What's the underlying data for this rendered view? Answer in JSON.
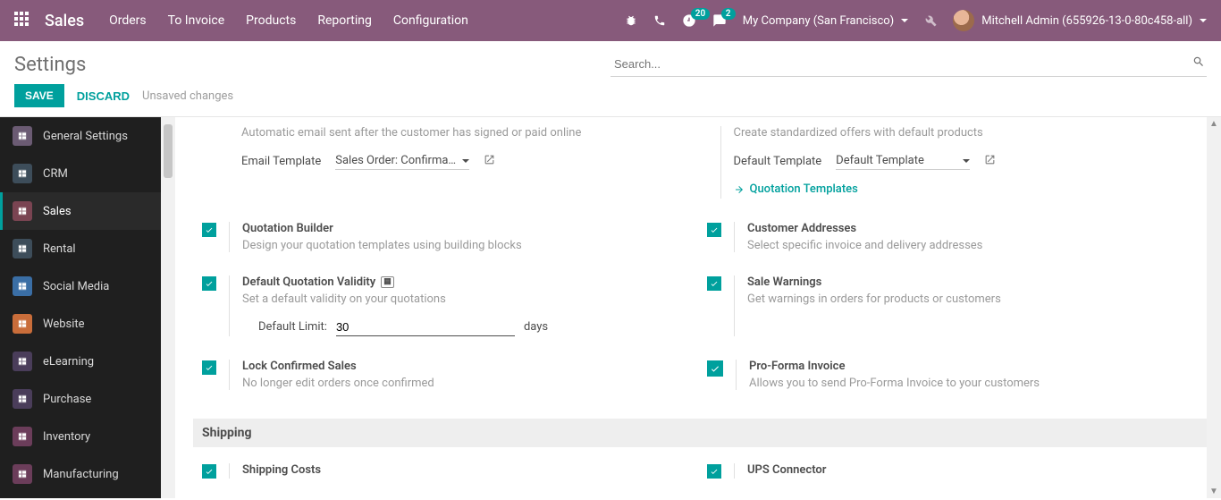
{
  "topnav": {
    "brand": "Sales",
    "menu": [
      "Orders",
      "To Invoice",
      "Products",
      "Reporting",
      "Configuration"
    ],
    "activity_badge": "20",
    "message_badge": "2",
    "company": "My Company (San Francisco)",
    "user": "Mitchell Admin (655926-13-0-80c458-all)"
  },
  "header": {
    "title": "Settings",
    "search_placeholder": "Search..."
  },
  "actions": {
    "save": "SAVE",
    "discard": "DISCARD",
    "status": "Unsaved changes"
  },
  "sidebar": [
    {
      "label": "General Settings",
      "color": "#6b5b73"
    },
    {
      "label": "CRM",
      "color": "#3d4d5a"
    },
    {
      "label": "Sales",
      "color": "#7a4452",
      "active": true
    },
    {
      "label": "Rental",
      "color": "#3d4d5a"
    },
    {
      "label": "Social Media",
      "color": "#3a6ea5"
    },
    {
      "label": "Website",
      "color": "#c96d3a"
    },
    {
      "label": "eLearning",
      "color": "#4a3d5a"
    },
    {
      "label": "Purchase",
      "color": "#4a3d5a"
    },
    {
      "label": "Inventory",
      "color": "#6b3d5a"
    },
    {
      "label": "Manufacturing",
      "color": "#6b3d5a"
    }
  ],
  "top_panel": {
    "left_hint": "Automatic email sent after the customer has signed or paid online",
    "left_field_label": "Email Template",
    "left_field_value": "Sales Order: Confirmatio",
    "right_hint": "Create standardized offers with default products",
    "right_field_label": "Default Template",
    "right_field_value": "Default Template",
    "quotation_link": "Quotation Templates"
  },
  "options": {
    "quotation_builder_title": "Quotation Builder",
    "quotation_builder_desc": "Design your quotation templates using building blocks",
    "customer_addresses_title": "Customer Addresses",
    "customer_addresses_desc": "Select specific invoice and delivery addresses",
    "default_validity_title": "Default Quotation Validity",
    "default_validity_desc": "Set a default validity on your quotations",
    "default_limit_label": "Default Limit:",
    "default_limit_value": "30",
    "default_limit_unit": "days",
    "sale_warnings_title": "Sale Warnings",
    "sale_warnings_desc": "Get warnings in orders for products or customers",
    "lock_confirmed_title": "Lock Confirmed Sales",
    "lock_confirmed_desc": "No longer edit orders once confirmed",
    "proforma_title": "Pro-Forma Invoice",
    "proforma_desc": "Allows you to send Pro-Forma Invoice to your customers"
  },
  "section_shipping": "Shipping",
  "shipping": {
    "shipping_costs": "Shipping Costs",
    "ups_connector": "UPS Connector"
  }
}
